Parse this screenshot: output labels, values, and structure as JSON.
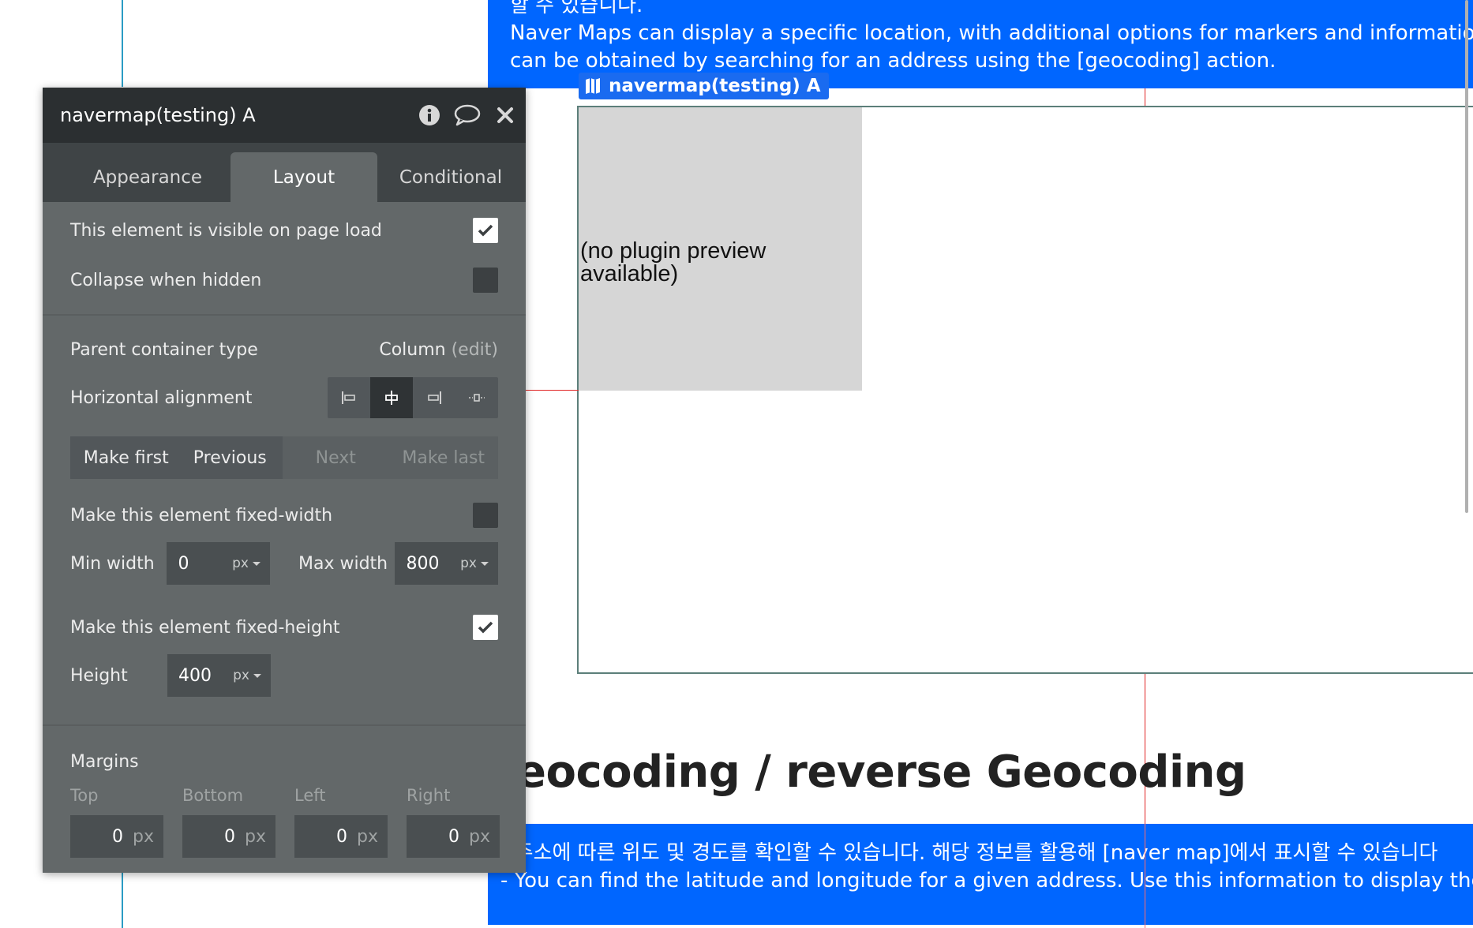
{
  "canvas": {
    "top_note": {
      "line_partial": "할 수 있습니다.",
      "line1": "Naver Maps can display a specific location, with additional options for markers and information windows",
      "line2": "can be obtained by searching for an address using the [geocoding] action."
    },
    "element_tag": "navermap(testing) A",
    "preview_text": "(no plugin preview available)",
    "section_heading": "eocoding / reverse Geocoding",
    "bottom_note": {
      "line1": "- 주소에 따른 위도 및 경도를 확인할 수 있습니다. 해당 정보를 활용해 [naver map]에서 표시할 수 있습니다",
      "line2": "- You can find the latitude and longitude for a given address. Use this information to display the location"
    }
  },
  "panel": {
    "title": "navermap(testing) A",
    "icons": [
      "info-icon",
      "comment-icon",
      "close-icon"
    ],
    "tabs": [
      {
        "label": "Appearance",
        "active": false
      },
      {
        "label": "Layout",
        "active": true
      },
      {
        "label": "Conditional",
        "active": false
      }
    ],
    "visible_on_load": {
      "label": "This element is visible on page load",
      "checked": true
    },
    "collapse_when_hidden": {
      "label": "Collapse when hidden",
      "checked": false
    },
    "parent_container": {
      "label": "Parent container type",
      "value": "Column",
      "edit": "(edit)"
    },
    "horizontal_alignment": {
      "label": "Horizontal alignment",
      "selected": "center"
    },
    "order_buttons": {
      "make_first": "Make first",
      "previous": "Previous",
      "next": "Next",
      "make_last": "Make last"
    },
    "fixed_width": {
      "label": "Make this element fixed-width",
      "checked": false
    },
    "min_width": {
      "label": "Min width",
      "value": "0",
      "unit": "px"
    },
    "max_width": {
      "label": "Max width",
      "value": "800",
      "unit": "px"
    },
    "fixed_height": {
      "label": "Make this element fixed-height",
      "checked": true
    },
    "height": {
      "label": "Height",
      "value": "400",
      "unit": "px"
    },
    "margins": {
      "title": "Margins",
      "top": {
        "label": "Top",
        "value": "0",
        "unit": "px"
      },
      "bottom": {
        "label": "Bottom",
        "value": "0",
        "unit": "px"
      },
      "left": {
        "label": "Left",
        "value": "0",
        "unit": "px"
      },
      "right": {
        "label": "Right",
        "value": "0",
        "unit": "px"
      }
    }
  },
  "colors": {
    "accent_blue": "#0066ff",
    "panel_bg": "#636869",
    "panel_header": "#2b2f31"
  }
}
